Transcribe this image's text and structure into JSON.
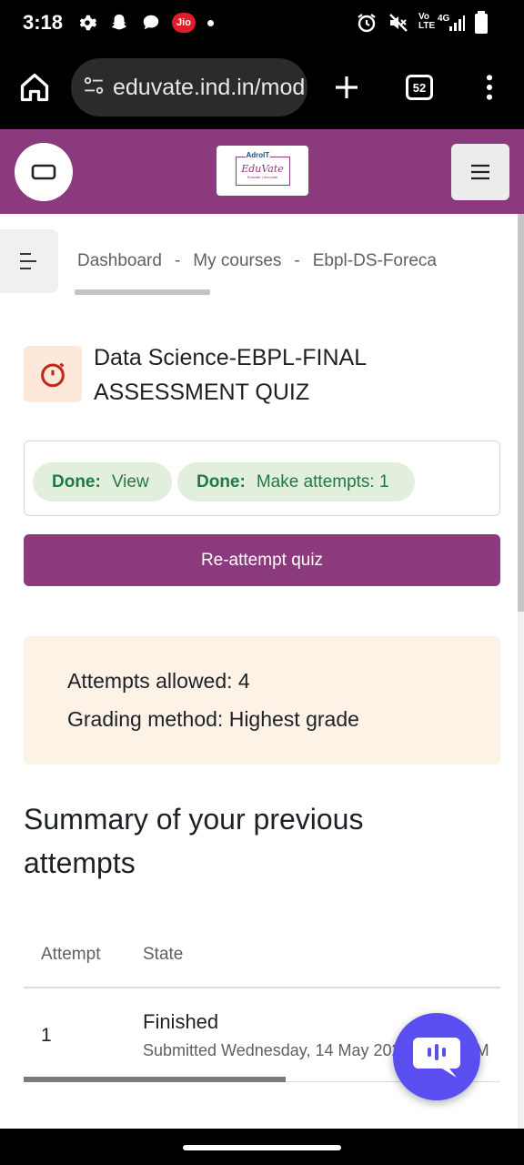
{
  "status_bar": {
    "time": "3:18",
    "carrier_badge": "Jio",
    "network_label_top": "Vo",
    "network_label_bottom": "LTE",
    "signal_label": "4G",
    "icons": [
      "settings-icon",
      "snapchat-icon",
      "chat-bubble-icon",
      "alarm-icon",
      "mute-icon",
      "signal-icon",
      "battery-icon"
    ]
  },
  "browser": {
    "url": "eduvate.ind.in/mod",
    "tab_count": "52"
  },
  "site": {
    "logo_top": "AdroIT",
    "logo_main": "EduVate",
    "logo_sub": "Educate | Innovate",
    "brand_color": "#8b3a7e"
  },
  "breadcrumb": {
    "items": [
      "Dashboard",
      "My courses",
      "Ebpl-DS-Foreca"
    ],
    "separator": "-"
  },
  "quiz": {
    "title": "Data Science-EBPL-FINAL ASSESSMENT QUIZ"
  },
  "completion": {
    "items": [
      {
        "status": "Done:",
        "label": "View"
      },
      {
        "status": "Done:",
        "label": "Make attempts: 1"
      }
    ]
  },
  "reattempt_button": "Re-attempt quiz",
  "info": {
    "attempts_allowed": "Attempts allowed: 4",
    "grading_method": "Grading method: Highest grade"
  },
  "summary": {
    "heading": "Summary of your previous attempts",
    "columns": [
      "Attempt",
      "State"
    ],
    "rows": [
      {
        "attempt": "1",
        "state": "Finished",
        "submitted": "Submitted Wednesday, 14 May 2025, 10:52 PM"
      }
    ]
  }
}
